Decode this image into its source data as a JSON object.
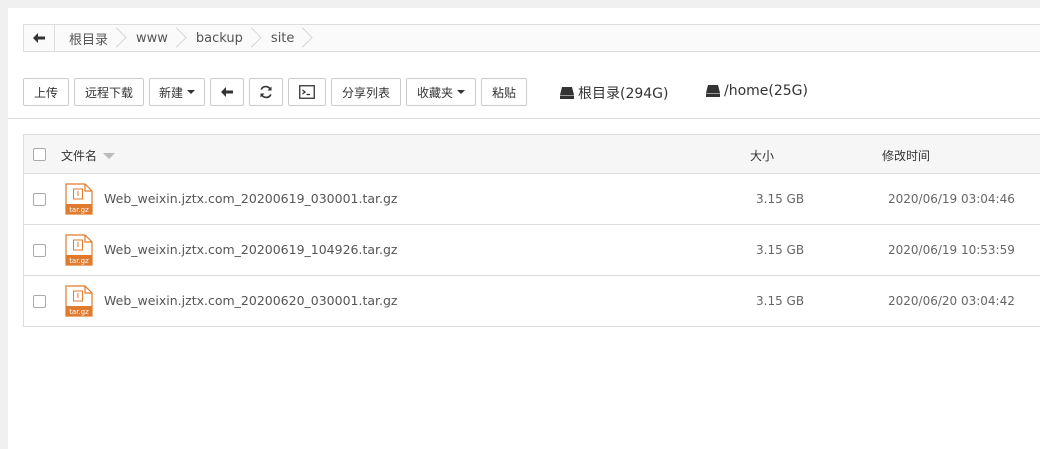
{
  "breadcrumb": {
    "items": [
      {
        "label": "根目录"
      },
      {
        "label": "www"
      },
      {
        "label": "backup"
      },
      {
        "label": "site"
      }
    ]
  },
  "toolbar": {
    "upload": "上传",
    "remote_download": "远程下载",
    "new": "新建",
    "share_list": "分享列表",
    "favorites": "收藏夹",
    "paste": "粘贴"
  },
  "disks": [
    {
      "label": "根目录(294G)"
    },
    {
      "label": "/home(25G)"
    }
  ],
  "table": {
    "headers": {
      "name": "文件名",
      "size": "大小",
      "time": "修改时间"
    },
    "rows": [
      {
        "name": "Web_weixin.jztx.com_20200619_030001.tar.gz",
        "size": "3.15 GB",
        "time": "2020/06/19 03:04:46",
        "icon_text": "tar.gz"
      },
      {
        "name": "Web_weixin.jztx.com_20200619_104926.tar.gz",
        "size": "3.15 GB",
        "time": "2020/06/19 10:53:59",
        "icon_text": "tar.gz"
      },
      {
        "name": "Web_weixin.jztx.com_20200620_030001.tar.gz",
        "size": "3.15 GB",
        "time": "2020/06/20 03:04:42",
        "icon_text": "tar.gz"
      }
    ]
  },
  "colors": {
    "archive_icon": "#e07a2e"
  }
}
